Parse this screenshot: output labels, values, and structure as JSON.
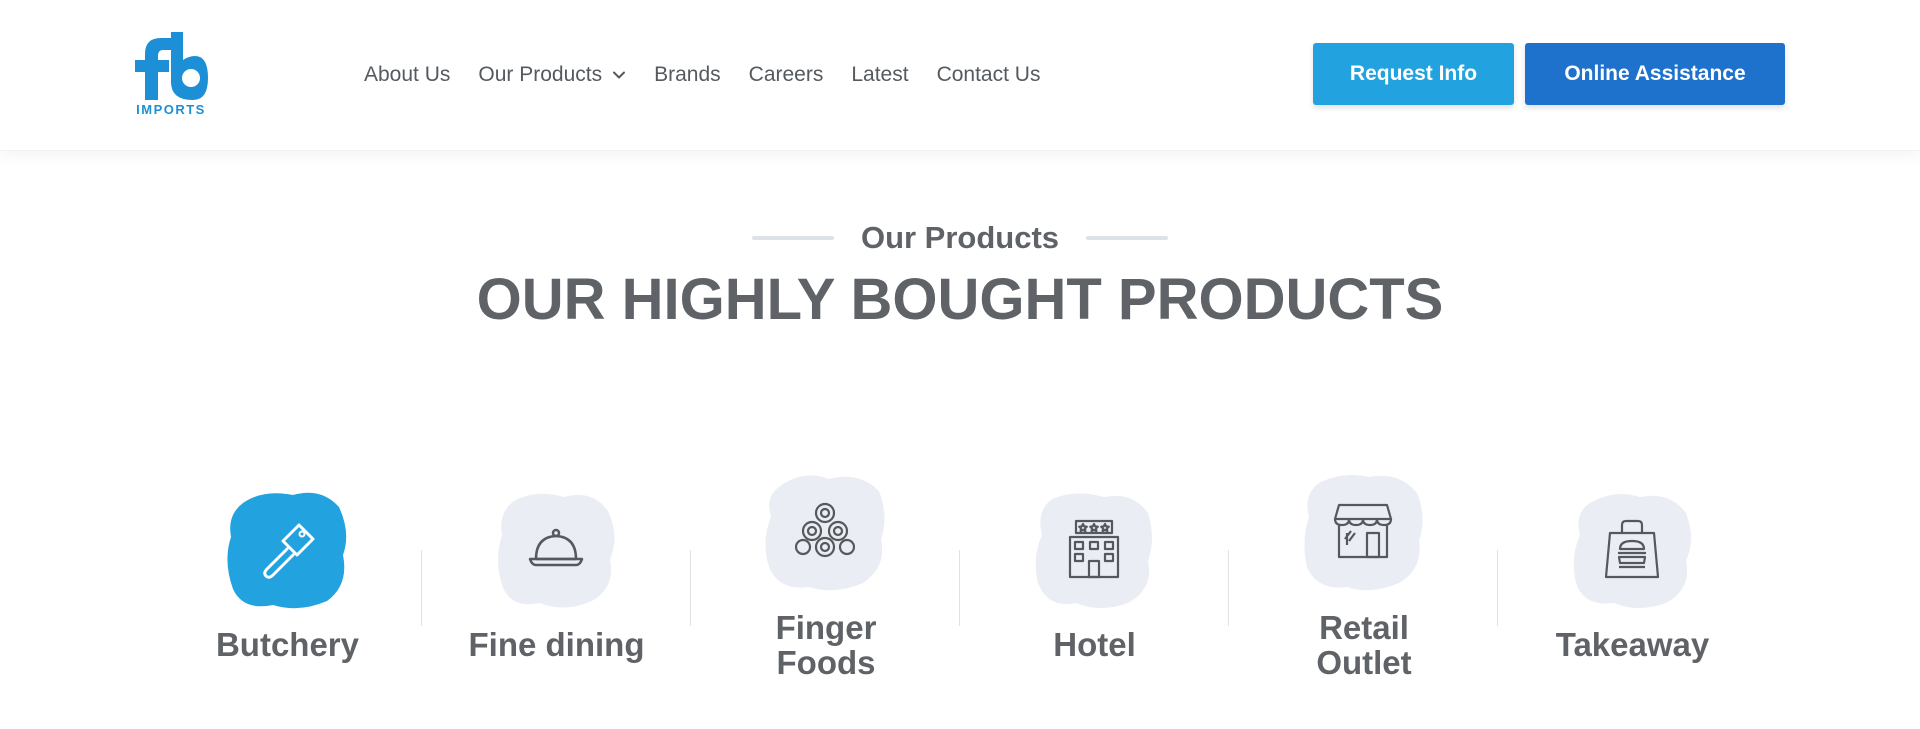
{
  "brand": {
    "logo_text": "IMPORTS",
    "color": "#1c8fd6"
  },
  "nav": {
    "items": [
      {
        "label": "About Us"
      },
      {
        "label": "Our Products",
        "has_dropdown": true
      },
      {
        "label": "Brands"
      },
      {
        "label": "Careers"
      },
      {
        "label": "Latest"
      },
      {
        "label": "Contact Us"
      }
    ]
  },
  "actions": {
    "request_label": "Request Info",
    "request_color": "#22a2df",
    "assist_label": "Online Assistance",
    "assist_color": "#1e72cc"
  },
  "section": {
    "subtitle": "Our Products",
    "title": "OUR HIGHLY BOUGHT PRODUCTS"
  },
  "categories": [
    {
      "label": "Butchery",
      "icon": "cleaver-icon",
      "active": true
    },
    {
      "label": "Fine dining",
      "icon": "cloche-icon",
      "active": false
    },
    {
      "label": "Finger Foods",
      "icon": "sushi-rolls-icon",
      "active": false
    },
    {
      "label": "Hotel",
      "icon": "hotel-building-icon",
      "active": false
    },
    {
      "label": "Retail Outlet",
      "icon": "storefront-icon",
      "active": false
    },
    {
      "label": "Takeaway",
      "icon": "takeaway-bag-icon",
      "active": false
    }
  ],
  "colors": {
    "active_badge": "#22a2df",
    "inactive_badge": "#eaedf3",
    "text": "#5f6266"
  }
}
